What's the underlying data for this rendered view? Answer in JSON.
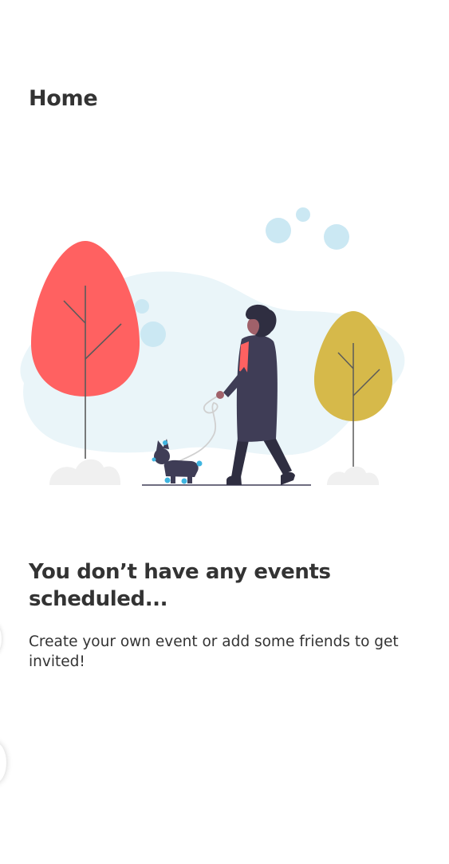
{
  "header": {
    "title": "Home"
  },
  "illustration": {
    "name": "walking-dog-illustration",
    "colors": {
      "background_blob": "#eaf5f9",
      "bubbles": "#cbe8f3",
      "red_tree": "#ff6161",
      "yellow_tree": "#d6b94a",
      "person_coat": "#3f3d56",
      "person_shirt": "#ff6161",
      "skin": "#a0616a",
      "hair": "#2f2e41",
      "dog_accent": "#3fb5e0",
      "bushes": "#f0f0f0"
    }
  },
  "empty_state": {
    "heading": "You don’t have any events scheduled...",
    "message": "Create your own event or add some friends to get invited!"
  }
}
